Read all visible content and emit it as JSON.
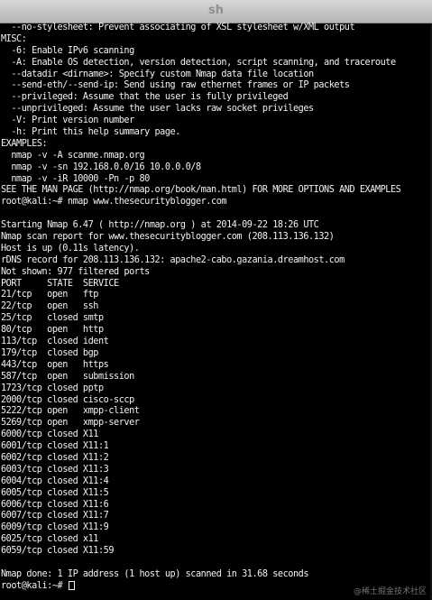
{
  "window": {
    "title": "sh"
  },
  "terminal": {
    "lines": [
      "  --no-stylesheet: Prevent associating of XSL stylesheet w/XML output",
      "MISC:",
      "  -6: Enable IPv6 scanning",
      "  -A: Enable OS detection, version detection, script scanning, and traceroute",
      "  --datadir <dirname>: Specify custom Nmap data file location",
      "  --send-eth/--send-ip: Send using raw ethernet frames or IP packets",
      "  --privileged: Assume that the user is fully privileged",
      "  --unprivileged: Assume the user lacks raw socket privileges",
      "  -V: Print version number",
      "  -h: Print this help summary page.",
      "EXAMPLES:",
      "  nmap -v -A scanme.nmap.org",
      "  nmap -v -sn 192.168.0.0/16 10.0.0.0/8",
      "  nmap -v -iR 10000 -Pn -p 80",
      "SEE THE MAN PAGE (http://nmap.org/book/man.html) FOR MORE OPTIONS AND EXAMPLES",
      "root@kali:~# nmap www.thesecurityblogger.com",
      "",
      "Starting Nmap 6.47 ( http://nmap.org ) at 2014-09-22 18:26 UTC",
      "Nmap scan report for www.thesecurityblogger.com (208.113.136.132)",
      "Host is up (0.11s latency).",
      "rDNS record for 208.113.136.132: apache2-cabo.gazania.dreamhost.com",
      "Not shown: 977 filtered ports",
      "PORT     STATE  SERVICE",
      "21/tcp   open   ftp",
      "22/tcp   open   ssh",
      "25/tcp   closed smtp",
      "80/tcp   open   http",
      "113/tcp  closed ident",
      "179/tcp  closed bgp",
      "443/tcp  open   https",
      "587/tcp  open   submission",
      "1723/tcp closed pptp",
      "2000/tcp closed cisco-sccp",
      "5222/tcp open   xmpp-client",
      "5269/tcp open   xmpp-server",
      "6000/tcp closed X11",
      "6001/tcp closed X11:1",
      "6002/tcp closed X11:2",
      "6003/tcp closed X11:3",
      "6004/tcp closed X11:4",
      "6005/tcp closed X11:5",
      "6006/tcp closed X11:6",
      "6007/tcp closed X11:7",
      "6009/tcp closed X11:9",
      "6025/tcp closed x11",
      "6059/tcp closed X11:59",
      "",
      "Nmap done: 1 IP address (1 host up) scanned in 31.68 seconds"
    ],
    "prompt": "root@kali:~# "
  },
  "watermark": {
    "text": "@稀土掘金技术社区"
  },
  "colors": {
    "background": "#000000",
    "foreground": "#f2f2f2",
    "titlebar": "#c6c6c6"
  }
}
